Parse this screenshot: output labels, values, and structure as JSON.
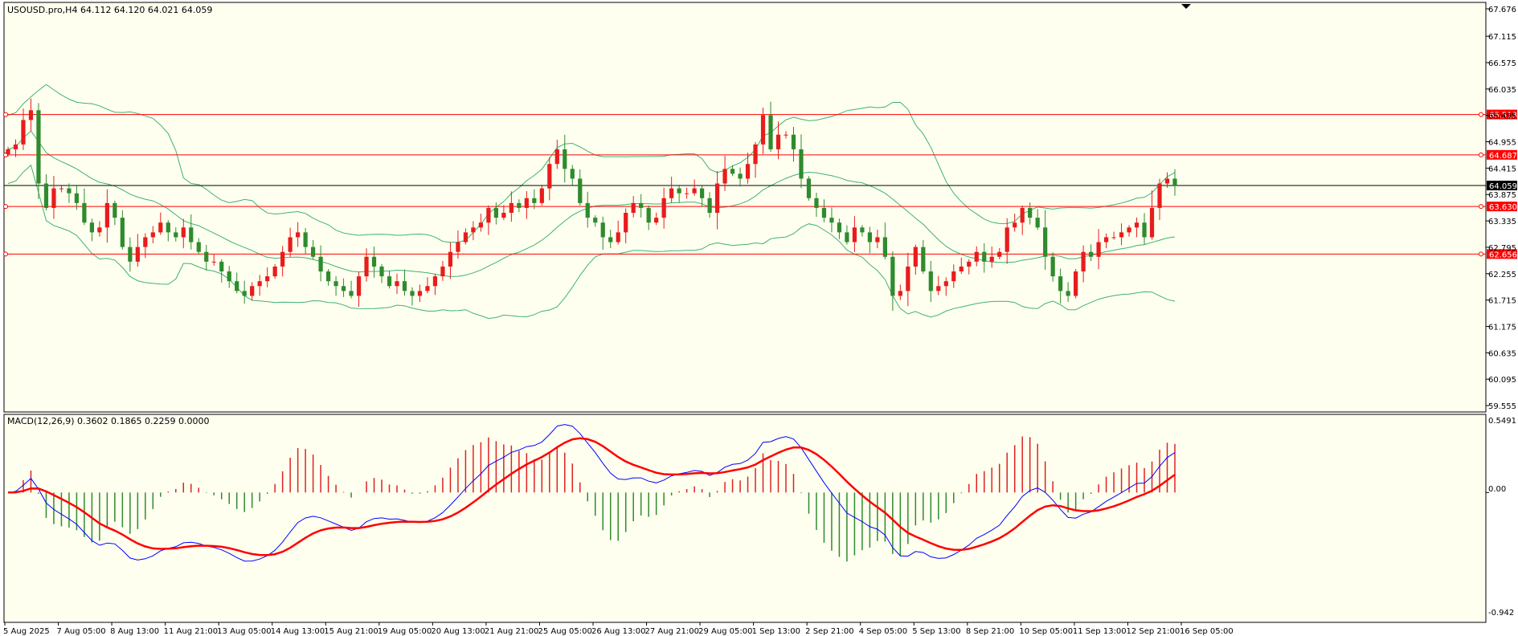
{
  "header": {
    "symbol_ohlc": "USOUSD.pro,H4  64.112 64.120 64.021 64.059"
  },
  "macd": {
    "label": "MACD(12,26,9) 0.3602 0.1865 0.2259 0.0000",
    "axis_labels": [
      "0.5491",
      "0.00",
      "-0.942"
    ]
  },
  "colors": {
    "background": "#fffff0",
    "bull": "#e81c1c",
    "bear": "#2e8b2e",
    "bands": "#3cb371",
    "level": "#ff0000",
    "current": "#000000",
    "macd_main": "#0000ff",
    "macd_signal": "#ff0000",
    "hist_pos": "#dd2222",
    "hist_neg": "#2e8b2e"
  },
  "chart_data": {
    "type": "candlestick",
    "symbol": "USOUSD.pro",
    "timeframe": "H4",
    "ylim": [
      59.555,
      67.676
    ],
    "y_ticks": [
      "67.676",
      "67.115",
      "66.575",
      "66.035",
      "65.495",
      "64.955",
      "64.415",
      "63.875",
      "63.335",
      "62.795",
      "62.255",
      "61.715",
      "61.175",
      "60.635",
      "60.095",
      "59.555"
    ],
    "x_ticks": [
      "5 Aug 2025",
      "7 Aug 05:00",
      "8 Aug 13:00",
      "11 Aug 21:00",
      "13 Aug 05:00",
      "14 Aug 13:00",
      "15 Aug 21:00",
      "19 Aug 05:00",
      "20 Aug 13:00",
      "21 Aug 21:00",
      "25 Aug 05:00",
      "26 Aug 13:00",
      "27 Aug 21:00",
      "29 Aug 05:00",
      "1 Sep 13:00",
      "2 Sep 21:00",
      "4 Sep 05:00",
      "5 Sep 13:00",
      "8 Sep 21:00",
      "10 Sep 05:00",
      "11 Sep 13:00",
      "12 Sep 21:00",
      "16 Sep 05:00"
    ],
    "levels": [
      {
        "value": 65.513,
        "label": "65.513"
      },
      {
        "value": 64.687,
        "label": "64.687"
      },
      {
        "value": 63.63,
        "label": "63.630"
      },
      {
        "value": 62.656,
        "label": "62.656"
      }
    ],
    "current_price": {
      "value": 64.059,
      "label": "64.059"
    },
    "closes": [
      64.8,
      64.9,
      65.4,
      65.6,
      64.1,
      63.6,
      64.0,
      64.0,
      63.9,
      63.7,
      63.3,
      63.1,
      63.2,
      63.7,
      63.4,
      62.8,
      62.5,
      62.8,
      63.0,
      63.1,
      63.3,
      63.1,
      63.0,
      63.2,
      62.9,
      62.7,
      62.5,
      62.5,
      62.3,
      62.1,
      61.9,
      61.8,
      62.0,
      62.1,
      62.2,
      62.4,
      62.7,
      63.0,
      63.1,
      62.8,
      62.6,
      62.3,
      62.1,
      62.0,
      61.9,
      61.8,
      62.2,
      62.6,
      62.4,
      62.2,
      62.0,
      62.1,
      61.9,
      61.8,
      61.9,
      62.0,
      62.2,
      62.4,
      62.7,
      62.9,
      63.1,
      63.2,
      63.3,
      63.6,
      63.4,
      63.5,
      63.7,
      63.6,
      63.8,
      63.7,
      64.0,
      64.5,
      64.8,
      64.4,
      64.2,
      63.7,
      63.4,
      63.3,
      63.0,
      62.9,
      63.1,
      63.5,
      63.7,
      63.6,
      63.3,
      63.4,
      63.8,
      64.0,
      63.9,
      63.9,
      64.0,
      63.8,
      63.5,
      64.1,
      64.4,
      64.3,
      64.2,
      64.5,
      64.9,
      65.5,
      64.8,
      65.1,
      65.1,
      64.8,
      64.2,
      63.8,
      63.6,
      63.4,
      63.3,
      63.1,
      62.9,
      63.2,
      63.1,
      62.9,
      63.0,
      62.6,
      61.8,
      61.9,
      62.4,
      62.8,
      62.3,
      61.9,
      62.0,
      62.1,
      62.3,
      62.4,
      62.5,
      62.7,
      62.5,
      62.6,
      62.7,
      63.2,
      63.3,
      63.6,
      63.4,
      63.2,
      62.6,
      62.2,
      61.9,
      61.8,
      62.3,
      62.7,
      62.6,
      62.9,
      63.0,
      63.0,
      63.1,
      63.2,
      63.3,
      63.0,
      63.6,
      64.1,
      64.2,
      64.059
    ],
    "bands": {
      "period": 20,
      "upper": [
        66.9,
        66.6,
        66.3,
        66.1,
        65.8,
        65.5,
        65.2,
        65.0,
        64.8,
        64.6,
        64.4,
        64.3,
        64.2,
        64.1,
        64.0,
        63.9,
        63.8,
        63.8,
        63.7,
        63.7,
        63.7,
        63.8,
        63.8,
        63.7,
        63.6,
        63.6,
        63.5,
        63.5,
        63.5,
        63.4,
        63.4,
        63.3,
        63.3,
        63.3,
        63.3,
        63.3,
        63.3,
        63.4,
        63.4,
        63.4,
        63.4,
        63.3,
        63.3,
        63.3,
        63.3,
        63.3,
        63.2,
        63.2,
        63.1,
        63.1,
        63.1,
        63.1,
        63.1,
        63.0,
        62.9,
        62.9,
        62.9,
        62.9,
        63.0,
        63.1,
        63.2,
        63.3,
        63.4,
        63.6,
        63.7,
        63.8,
        64.0,
        64.1,
        64.3,
        64.4,
        64.6,
        64.8,
        65.0,
        65.0,
        64.9,
        64.8,
        64.8,
        64.7,
        64.7,
        64.7,
        64.7,
        64.7,
        64.6,
        64.5,
        64.3,
        64.2,
        64.2,
        64.2,
        64.2,
        64.2,
        64.3,
        64.2,
        64.0,
        64.0,
        64.0,
        64.1,
        64.3,
        64.4,
        64.6,
        65.0,
        65.2,
        65.4,
        65.6,
        65.7,
        65.8,
        65.8,
        65.9,
        65.9,
        65.9,
        65.9,
        65.8,
        65.7,
        65.5,
        64.9,
        64.5,
        64.2,
        63.9,
        63.6,
        63.4,
        63.2,
        63.0,
        62.9,
        62.9,
        63.0,
        63.2,
        63.2,
        63.3,
        63.3,
        63.3,
        63.4,
        63.4,
        63.5,
        63.5,
        63.6,
        63.6,
        63.6,
        63.6,
        63.6,
        63.6,
        63.6,
        63.6,
        63.6,
        63.6,
        63.6,
        63.6,
        63.7,
        63.7,
        63.6,
        63.6,
        63.6,
        63.6,
        63.6,
        63.8,
        64.2,
        64.4,
        64.6
      ],
      "middle": [
        65.0,
        64.9,
        64.8,
        64.7,
        64.5,
        64.3,
        64.1,
        64.0,
        63.8,
        63.7,
        63.6,
        63.5,
        63.4,
        63.4,
        63.3,
        63.2,
        63.1,
        63.0,
        63.0,
        62.9,
        62.9,
        62.8,
        62.8,
        62.7,
        62.7,
        62.7,
        62.6,
        62.6,
        62.6,
        62.5,
        62.5,
        62.4,
        62.4,
        62.4,
        62.4,
        62.4,
        62.4,
        62.4,
        62.4,
        62.4,
        62.4,
        62.3,
        62.3,
        62.3,
        62.3,
        62.3,
        62.3,
        62.3,
        62.3,
        62.2,
        62.2,
        62.2,
        62.2,
        62.2,
        62.1,
        62.1,
        62.1,
        62.2,
        62.2,
        62.3,
        62.3,
        62.4,
        62.5,
        62.6,
        62.7,
        62.8,
        62.9,
        63.0,
        63.1,
        63.2,
        63.4,
        63.5,
        63.7,
        63.8,
        63.8,
        63.8,
        63.8,
        63.8,
        63.8,
        63.7,
        63.7,
        63.7,
        63.7,
        63.7,
        63.6,
        63.6,
        63.6,
        63.7,
        63.7,
        63.7,
        63.8,
        63.8,
        63.7,
        63.8,
        63.9,
        64.0,
        64.1,
        64.2,
        64.3,
        64.5,
        64.5,
        64.6,
        64.6,
        64.6,
        64.6,
        64.5,
        64.4,
        64.3,
        64.2,
        64.0,
        63.9,
        63.8,
        63.7,
        63.5,
        63.3,
        63.1,
        63.0,
        62.9,
        62.8,
        62.7,
        62.6,
        62.5,
        62.5,
        62.4,
        62.4,
        62.4,
        62.4,
        62.4,
        62.4,
        62.4,
        62.4,
        62.5,
        62.5,
        62.5,
        62.5,
        62.5,
        62.4,
        62.4,
        62.4,
        62.4,
        62.4,
        62.4,
        62.4,
        62.5,
        62.5,
        62.6,
        62.6,
        62.6,
        62.6,
        62.6,
        62.7,
        62.8,
        62.9,
        63.1
      ],
      "lower": [
        63.1,
        63.2,
        63.3,
        63.3,
        63.2,
        63.1,
        63.0,
        63.0,
        62.8,
        62.8,
        62.8,
        62.7,
        62.6,
        62.7,
        62.6,
        62.5,
        62.4,
        62.2,
        62.3,
        62.1,
        62.1,
        61.8,
        61.8,
        61.7,
        61.8,
        61.8,
        61.7,
        61.7,
        61.7,
        61.6,
        61.6,
        61.5,
        61.5,
        61.5,
        61.5,
        61.5,
        61.5,
        61.4,
        61.4,
        61.4,
        61.4,
        61.3,
        61.3,
        61.3,
        61.3,
        61.3,
        61.4,
        61.4,
        61.5,
        61.3,
        61.3,
        61.3,
        61.3,
        61.4,
        61.3,
        61.3,
        61.3,
        61.5,
        61.4,
        61.5,
        61.4,
        61.5,
        61.6,
        61.6,
        61.7,
        61.8,
        61.8,
        61.9,
        61.9,
        62.0,
        62.2,
        62.2,
        62.4,
        62.6,
        62.7,
        62.8,
        62.8,
        62.9,
        62.9,
        62.7,
        62.7,
        62.7,
        62.8,
        62.9,
        62.9,
        63.0,
        63.0,
        63.2,
        63.2,
        63.2,
        63.3,
        63.4,
        63.4,
        63.6,
        63.8,
        63.9,
        63.9,
        64.0,
        64.0,
        64.0,
        63.8,
        63.8,
        63.6,
        63.5,
        63.4,
        63.2,
        62.9,
        62.7,
        62.5,
        62.1,
        62.0,
        61.9,
        61.9,
        62.1,
        62.1,
        62.1,
        62.2,
        61.9,
        62.0,
        62.0,
        61.8,
        61.9,
        62.1,
        61.8,
        61.6,
        61.6,
        61.6,
        61.5,
        61.5,
        61.5,
        61.4,
        61.5,
        61.6,
        61.6,
        61.6,
        61.6,
        61.5,
        61.5,
        61.5,
        61.5,
        61.6,
        61.6,
        61.6,
        61.6,
        61.6,
        61.6,
        61.6,
        61.6,
        61.5,
        61.5,
        61.4,
        61.5,
        61.5,
        61.5,
        61.5,
        61.5,
        61.6,
        61.4
      ],
      "_note": "not used"
    }
  }
}
